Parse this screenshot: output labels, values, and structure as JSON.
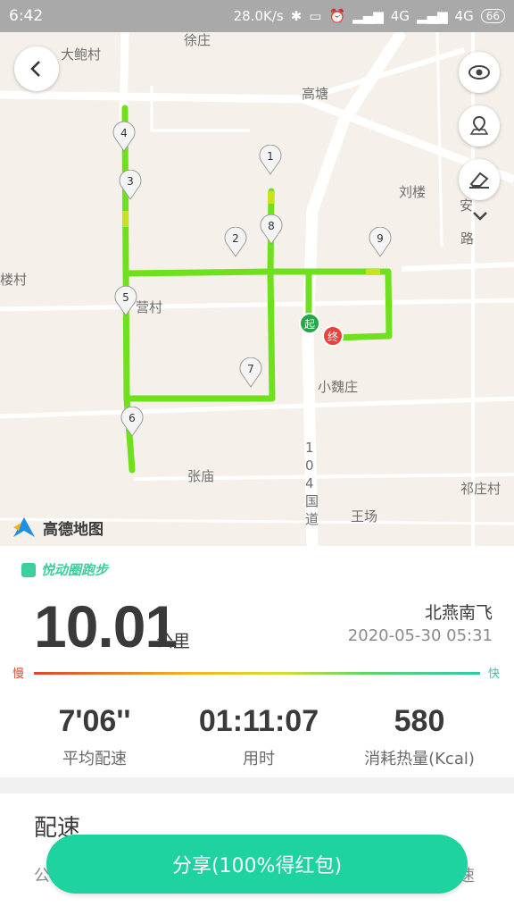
{
  "status_bar": {
    "time": "6:42",
    "network_speed": "28.0K/s",
    "signal_1": "4G",
    "signal_2": "4G",
    "battery": "66"
  },
  "map": {
    "labels": {
      "village_1": "大鲍村",
      "xuzhuang": "徐庄",
      "gaotang": "高塘",
      "liulou": "刘楼",
      "an": "安",
      "lu": "路",
      "lou_cun": "楼村",
      "ying_cun": "营村",
      "xiaoweizhuang": "小魏庄",
      "zhangmiao": "张庙",
      "qizhuangcun": "祁庄村",
      "wangchang": "王场",
      "road_104": "104国道"
    },
    "markers": [
      "1",
      "2",
      "3",
      "4",
      "5",
      "6",
      "7",
      "8",
      "9"
    ],
    "start_label": "起",
    "end_label": "终",
    "logo_text": "高德地图"
  },
  "run": {
    "brand": "悦动圈跑步",
    "distance": "10.01",
    "distance_unit": "公里",
    "user_name": "北燕南飞",
    "date": "2020-05-30 05:31",
    "slow_label": "慢",
    "fast_label": "快",
    "stats": [
      {
        "value": "7'06''",
        "label": "平均配速"
      },
      {
        "value": "01:11:07",
        "label": "用时"
      },
      {
        "value": "580",
        "label": "消耗热量(Kcal)"
      }
    ]
  },
  "pace_section": {
    "title": "配速",
    "left_sub": "公",
    "right_sub": "速"
  },
  "share_button": "分享(100%得红包)",
  "colors": {
    "accent": "#1ed3a0",
    "route_green": "#6ee01c",
    "start_marker": "#22a845",
    "end_marker": "#e8433d"
  }
}
